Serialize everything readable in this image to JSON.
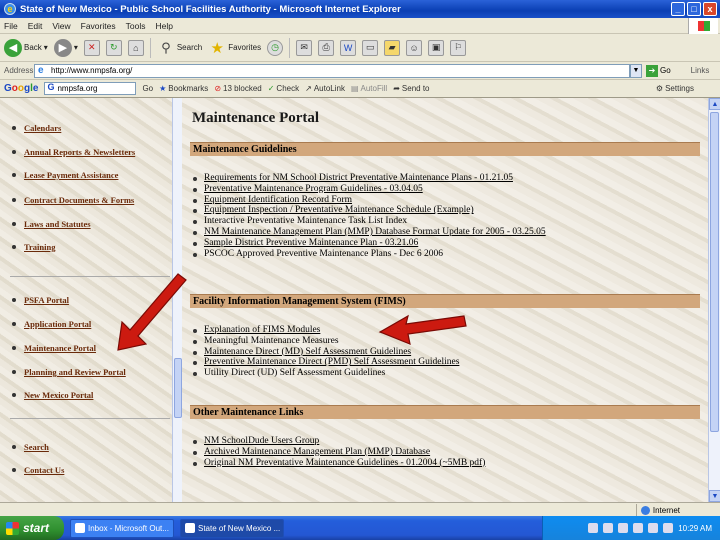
{
  "window": {
    "title": "State of New Mexico - Public School Facilities Authority - Microsoft Internet Explorer",
    "controls": [
      "_",
      "□",
      "x"
    ]
  },
  "menu": [
    "File",
    "Edit",
    "View",
    "Favorites",
    "Tools",
    "Help"
  ],
  "toolbar": {
    "back": "Back",
    "search": "Search",
    "favorites": "Favorites"
  },
  "address": {
    "label": "Address",
    "url": "http://www.nmpsfa.org/",
    "go": "Go",
    "links": "Links"
  },
  "google_bar": {
    "logo": "Google",
    "query": "nmpsfa.org",
    "go_label": "Go",
    "bookmarks": "Bookmarks",
    "blocked": "13 blocked",
    "check": "Check",
    "autolink": "AutoLink",
    "autofill": "AutoFill",
    "send_to": "Send to",
    "settings": "Settings"
  },
  "sidebar": {
    "items": [
      "Calendars",
      "Annual Reports & Newsletters",
      "Lease Payment Assistance",
      "Contract Documents & Forms",
      "Laws and Statutes",
      "Training",
      "PSFA Portal",
      "Application Portal",
      "Maintenance Portal",
      "Planning and Review Portal",
      "New Mexico Portal",
      "Search",
      "Contact Us"
    ]
  },
  "main": {
    "title": "Maintenance Portal",
    "sections": [
      {
        "header": "Maintenance Guidelines",
        "links": [
          "Requirements for NM School District Preventative Maintenance Plans - 01.21.05",
          "Preventative Maintenance Program Guidelines - 03.04.05",
          "Equipment Identification Record Form",
          "Equipment Inspection / Preventative Maintenance Schedule (Example)",
          "Interactive Preventative Maintenance Task List Index",
          "NM Maintenance Management Plan (MMP) Database Format Update for 2005 - 03.25.05",
          "Sample District Preventive Maintenance Plan - 03.21.06",
          "PSCOC Approved Preventive Maintenance Plans - Dec 6 2006"
        ]
      },
      {
        "header": "Facility Information Management System (FIMS)",
        "links": [
          "Explanation of FIMS Modules",
          "Meaningful Maintenance Measures",
          "Maintenance Direct (MD) Self Assessment Guidelines",
          "Preventive Maintenance Direct (PMD) Self Assessment Guidelines",
          "Utility Direct (UD) Self Assessment Guidelines"
        ]
      },
      {
        "header": "Other Maintenance Links",
        "links": [
          "NM SchoolDude Users Group",
          "Archived Maintenance Management Plan (MMP) Database",
          "Original NM Preventative Maintenance Guidelines - 01.2004 (~5MB pdf)"
        ]
      }
    ]
  },
  "status": {
    "zone": "Internet"
  },
  "taskbar": {
    "start": "start",
    "tasks": [
      "Inbox - Microsoft Out...",
      "State of New Mexico ..."
    ],
    "clock": "10:29 AM"
  },
  "colors": {
    "section_header": "#d2a77c",
    "sidebar_link": "#6a2a0a",
    "arrow": "#cc1a10"
  }
}
